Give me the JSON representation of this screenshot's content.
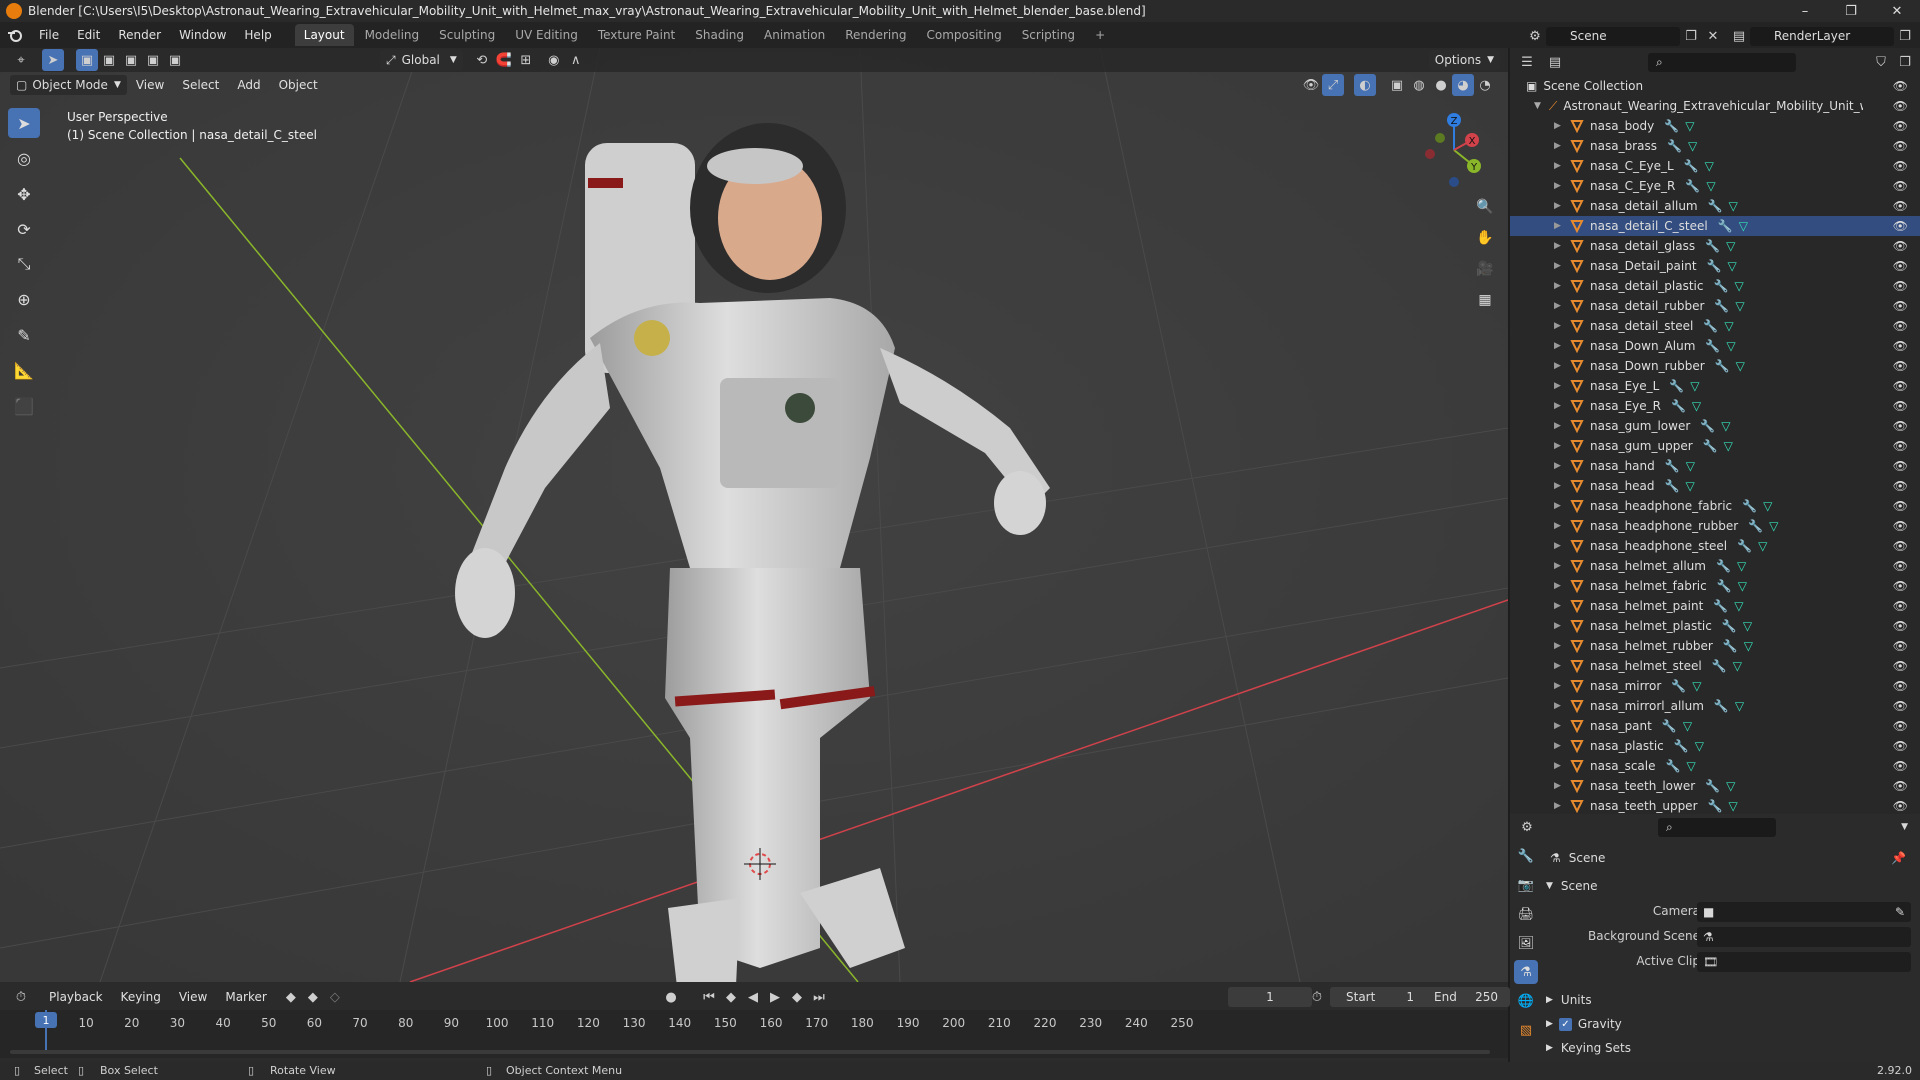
{
  "window": {
    "title": "Blender [C:\\Users\\I5\\Desktop\\Astronaut_Wearing_Extravehicular_Mobility_Unit_with_Helmet_max_vray\\Astronaut_Wearing_Extravehicular_Mobility_Unit_with_Helmet_blender_base.blend]",
    "controls": [
      "–",
      "❐",
      "✕"
    ]
  },
  "menu": [
    "File",
    "Edit",
    "Render",
    "Window",
    "Help"
  ],
  "workspaces": [
    "Layout",
    "Modeling",
    "Sculpting",
    "UV Editing",
    "Texture Paint",
    "Shading",
    "Animation",
    "Rendering",
    "Compositing",
    "Scripting",
    "+"
  ],
  "scene_name": "Scene",
  "view_layer": "RenderLayer",
  "viewport": {
    "mode": "Object Mode",
    "menus": [
      "View",
      "Select",
      "Add",
      "Object"
    ],
    "orientation": "Global",
    "options_label": "Options",
    "perspective": "User Perspective",
    "collection_info": "(1) Scene Collection | nasa_detail_C_steel",
    "gizmo_axes": [
      "Z",
      "Y",
      "X"
    ]
  },
  "outliner": {
    "root": "Scene Collection",
    "collection": "Astronaut_Wearing_Extravehicular_Mobility_Unit_with_Helm",
    "objects": [
      "nasa_body",
      "nasa_brass",
      "nasa_C_Eye_L",
      "nasa_C_Eye_R",
      "nasa_detail_allum",
      "nasa_detail_C_steel",
      "nasa_detail_glass",
      "nasa_Detail_paint",
      "nasa_detail_plastic",
      "nasa_detail_rubber",
      "nasa_detail_steel",
      "nasa_Down_Alum",
      "nasa_Down_rubber",
      "nasa_Eye_L",
      "nasa_Eye_R",
      "nasa_gum_lower",
      "nasa_gum_upper",
      "nasa_hand",
      "nasa_head",
      "nasa_headphone_fabric",
      "nasa_headphone_rubber",
      "nasa_headphone_steel",
      "nasa_helmet_allum",
      "nasa_helmet_fabric",
      "nasa_helmet_paint",
      "nasa_helmet_plastic",
      "nasa_helmet_rubber",
      "nasa_helmet_steel",
      "nasa_mirror",
      "nasa_mirrorl_allum",
      "nasa_pant",
      "nasa_plastic",
      "nasa_scale",
      "nasa_teeth_lower",
      "nasa_teeth_upper"
    ],
    "active_object": "nasa_detail_C_steel"
  },
  "properties": {
    "context": "Scene",
    "panel": "Scene",
    "camera_label": "Camera",
    "background_scene_label": "Background Scene",
    "active_clip_label": "Active Clip",
    "subpanels": [
      "Units",
      "Gravity",
      "Keying Sets"
    ],
    "gravity_checked": true
  },
  "timeline": {
    "menus": [
      "Playback",
      "Keying",
      "View",
      "Marker"
    ],
    "current_frame": "1",
    "start_label": "Start",
    "start": "1",
    "end_label": "End",
    "end": "250",
    "ticks": [
      "1",
      "10",
      "20",
      "30",
      "40",
      "50",
      "60",
      "70",
      "80",
      "90",
      "100",
      "110",
      "120",
      "130",
      "140",
      "150",
      "160",
      "170",
      "180",
      "190",
      "200",
      "210",
      "220",
      "230",
      "240",
      "250"
    ]
  },
  "status": {
    "select": "Select",
    "box_select": "Box Select",
    "rotate": "Rotate View",
    "context_menu": "Object Context Menu",
    "version": "2.92.0"
  },
  "colors": {
    "accent": "#4772b3",
    "viewport_bg": "#3d3d3d",
    "x_axis": "#d2424b",
    "y_axis": "#8ab62a",
    "z_axis": "#2f7de1",
    "object_orange": "#e88b2e",
    "modifier_blue": "#89a9f7",
    "mesh_green": "#35e0b9"
  }
}
